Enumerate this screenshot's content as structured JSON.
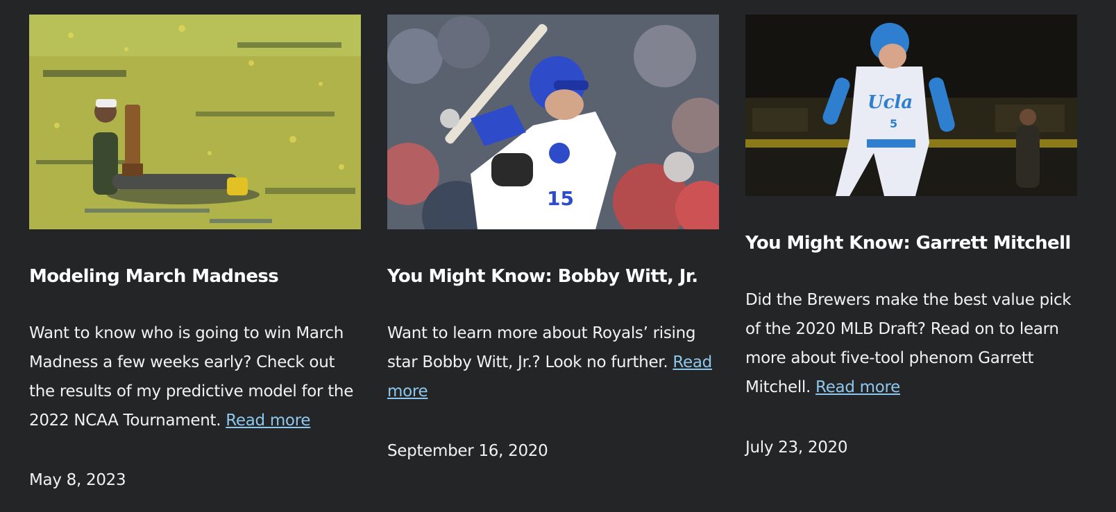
{
  "posts": [
    {
      "image_alt": "Basketball player sitting on confetti-covered court holding championship trophy",
      "title": "Modeling March Madness",
      "excerpt": "Want to know who is going to win March Madness a few weeks early? Check out the results of my predictive model for the 2022 NCAA Tournament.",
      "read_more": "Read more",
      "date": "May 8, 2023"
    },
    {
      "image_alt": "Baseball batter in blue helmet and white jersey number 15",
      "title": "You Might Know: Bobby Witt, Jr.",
      "excerpt": "Want to learn more about Royals’ rising star Bobby Witt, Jr.? Look no further.",
      "read_more": "Read more",
      "date": "September 16, 2020"
    },
    {
      "image_alt": "UCLA baseball player number 5 running the bases",
      "title": "You Might Know: Garrett Mitchell",
      "excerpt": "Did the Brewers make the best value pick of the 2020 MLB Draft? Read on to learn more about five-tool phenom Garrett Mitchell.",
      "read_more": "Read more",
      "date": "July 23, 2020"
    }
  ],
  "colors": {
    "background": "#242526",
    "text": "#f2f2f2",
    "link": "#8ec8ee"
  }
}
